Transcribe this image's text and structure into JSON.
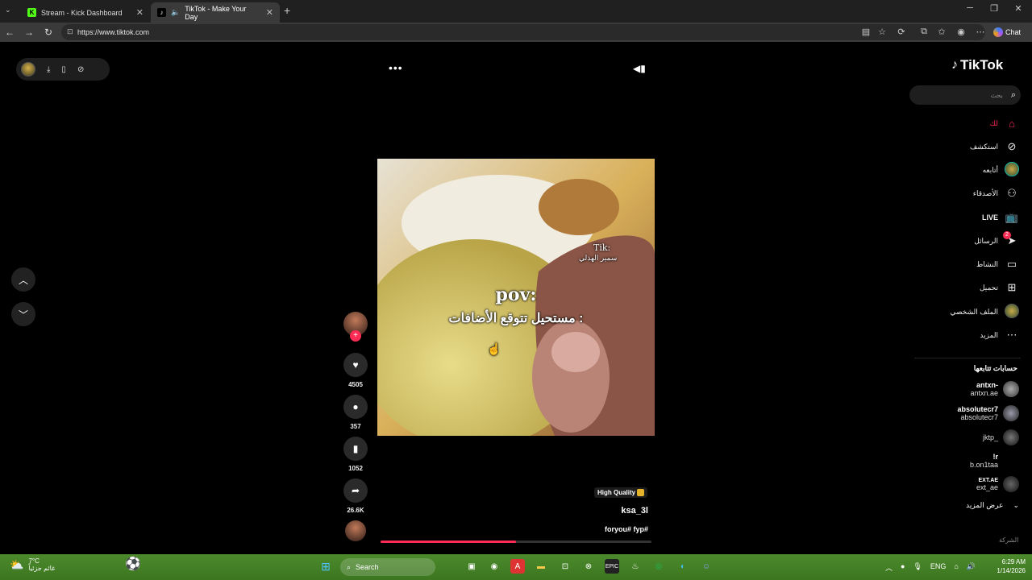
{
  "browser": {
    "tabs": [
      {
        "label": "Stream - Kick Dashboard",
        "favicon": "K"
      },
      {
        "label": "TikTok - Make Your Day",
        "favicon": "♪"
      }
    ],
    "url": "https://www.tiktok.com",
    "chat_label": "Chat"
  },
  "player": {
    "video_overlay": {
      "watermark_top": "Tik:",
      "watermark_name": "سمير الهذلي",
      "pov": "pov:",
      "caption_ar": "مستحيل تتوقع الأضافات :"
    },
    "likes": "4505",
    "comments": "357",
    "saves": "1052",
    "shares": "26.6K",
    "quality_badge": "High Quality",
    "username": "ksa_3l",
    "hashtags": "foryou# fyp#",
    "progress": 0.5
  },
  "sidebar": {
    "logo": "TikTok",
    "search_placeholder": "بحث",
    "nav": [
      {
        "label": "لك",
        "icon": "home-icon"
      },
      {
        "label": "استكشف",
        "icon": "compass-icon"
      },
      {
        "label": "أتابعه",
        "icon": "avatar"
      },
      {
        "label": "الأصدقاء",
        "icon": "friends-icon"
      },
      {
        "label": "LIVE",
        "icon": "live-icon"
      },
      {
        "label": "الرسائل",
        "icon": "send-icon",
        "badge": "2"
      },
      {
        "label": "النشاط",
        "icon": "activity-icon"
      },
      {
        "label": "تحميل",
        "icon": "upload-icon"
      },
      {
        "label": "الملف الشخصي",
        "icon": "profile-icon"
      },
      {
        "label": "المزيد",
        "icon": "more-icon"
      }
    ],
    "following_title": "حسابات تتابعها",
    "following": [
      {
        "name": "antxn-",
        "handle": "antxn.ae"
      },
      {
        "name": "absolutecr7",
        "handle": "absolutecr7"
      },
      {
        "name": "",
        "handle": "jktp_"
      },
      {
        "name": "!r",
        "handle": "b.on1taa"
      },
      {
        "name": "EXT.AE",
        "handle": "ext_ae"
      }
    ],
    "see_more": "عرض المزيد",
    "footer": "الشركة"
  },
  "taskbar": {
    "weather_temp": "7°C",
    "weather_desc": "غائم جزئياً",
    "search": "Search",
    "lang": "ENG",
    "time": "6:29 AM",
    "date": "1/14/2026"
  }
}
